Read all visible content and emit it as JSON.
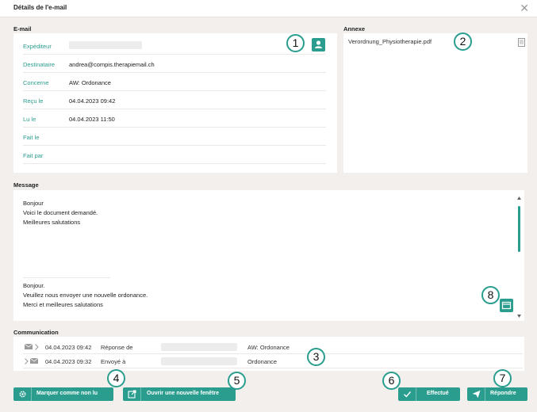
{
  "window": {
    "title": "Détails de l'e-mail",
    "close_glyph": "✕"
  },
  "colors": {
    "accent": "#2a9d8f",
    "background": "#f2efec",
    "panel": "#ffffff"
  },
  "email_section": {
    "label": "E-mail",
    "fields": [
      {
        "label": "Expéditeur",
        "value": ""
      },
      {
        "label": "Destinataire",
        "value": "andrea@compis.therapiemail.ch"
      },
      {
        "label": "Concerne",
        "value": "AW: Ordonance"
      },
      {
        "label": "Reçu le",
        "value": "04.04.2023 09:42"
      },
      {
        "label": "Lu le",
        "value": "04.04.2023 11:50"
      },
      {
        "label": "Fait le",
        "value": ""
      },
      {
        "label": "Fait par",
        "value": ""
      }
    ],
    "contact_icon": "person-icon"
  },
  "attachment_section": {
    "label": "Annexe",
    "files": [
      {
        "name": "Verordnung_Physiotherapie.pdf",
        "icon": "document-icon"
      }
    ]
  },
  "message_section": {
    "label": "Message",
    "lines_top": [
      "Bonjour",
      "Voici le document demandé.",
      "Meilleures salutations"
    ],
    "lines_bottom": [
      "Bonjour.",
      "Veuillez nous envoyer une nouvelle ordonance.",
      "Merci et meilleures salutations"
    ],
    "expand_icon": "window-icon"
  },
  "communication_section": {
    "label": "Communication",
    "rows": [
      {
        "date": "04.04.2023 09:42",
        "type": "Réponse de",
        "subject": "AW: Ordonance",
        "direction": "incoming"
      },
      {
        "date": "04.04.2023 09:32",
        "type": "Envoyé à",
        "subject": "Ordonance",
        "direction": "outgoing"
      }
    ]
  },
  "buttons": {
    "mark_unread": "Marquer comme non lu",
    "open_new_window": "Ouvrir une nouvelle fenêtre",
    "done": "Effectué",
    "reply": "Répondre"
  },
  "callouts": [
    "1",
    "2",
    "3",
    "4",
    "5",
    "6",
    "7",
    "8"
  ]
}
